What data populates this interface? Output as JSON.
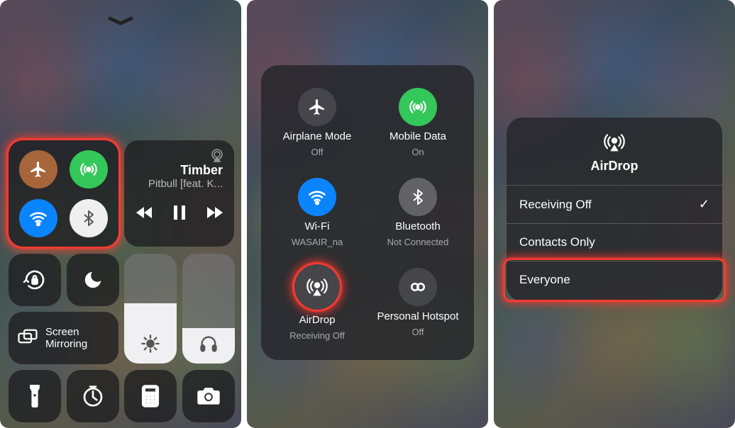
{
  "panel1": {
    "music": {
      "title": "Timber",
      "subtitle": "Pitbull [feat. K..."
    },
    "mirror_label": "Screen\nMirroring"
  },
  "panel2": {
    "items": [
      {
        "label": "Airplane Mode",
        "sub": "Off"
      },
      {
        "label": "Mobile Data",
        "sub": "On"
      },
      {
        "label": "Wi-Fi",
        "sub": "WASAIR_na"
      },
      {
        "label": "Bluetooth",
        "sub": "Not Connected"
      },
      {
        "label": "AirDrop",
        "sub": "Receiving Off"
      },
      {
        "label": "Personal Hotspot",
        "sub": "Off"
      }
    ]
  },
  "panel3": {
    "title": "AirDrop",
    "options": [
      "Receiving Off",
      "Contacts Only",
      "Everyone"
    ],
    "selected": "Receiving Off",
    "highlighted": "Everyone"
  }
}
